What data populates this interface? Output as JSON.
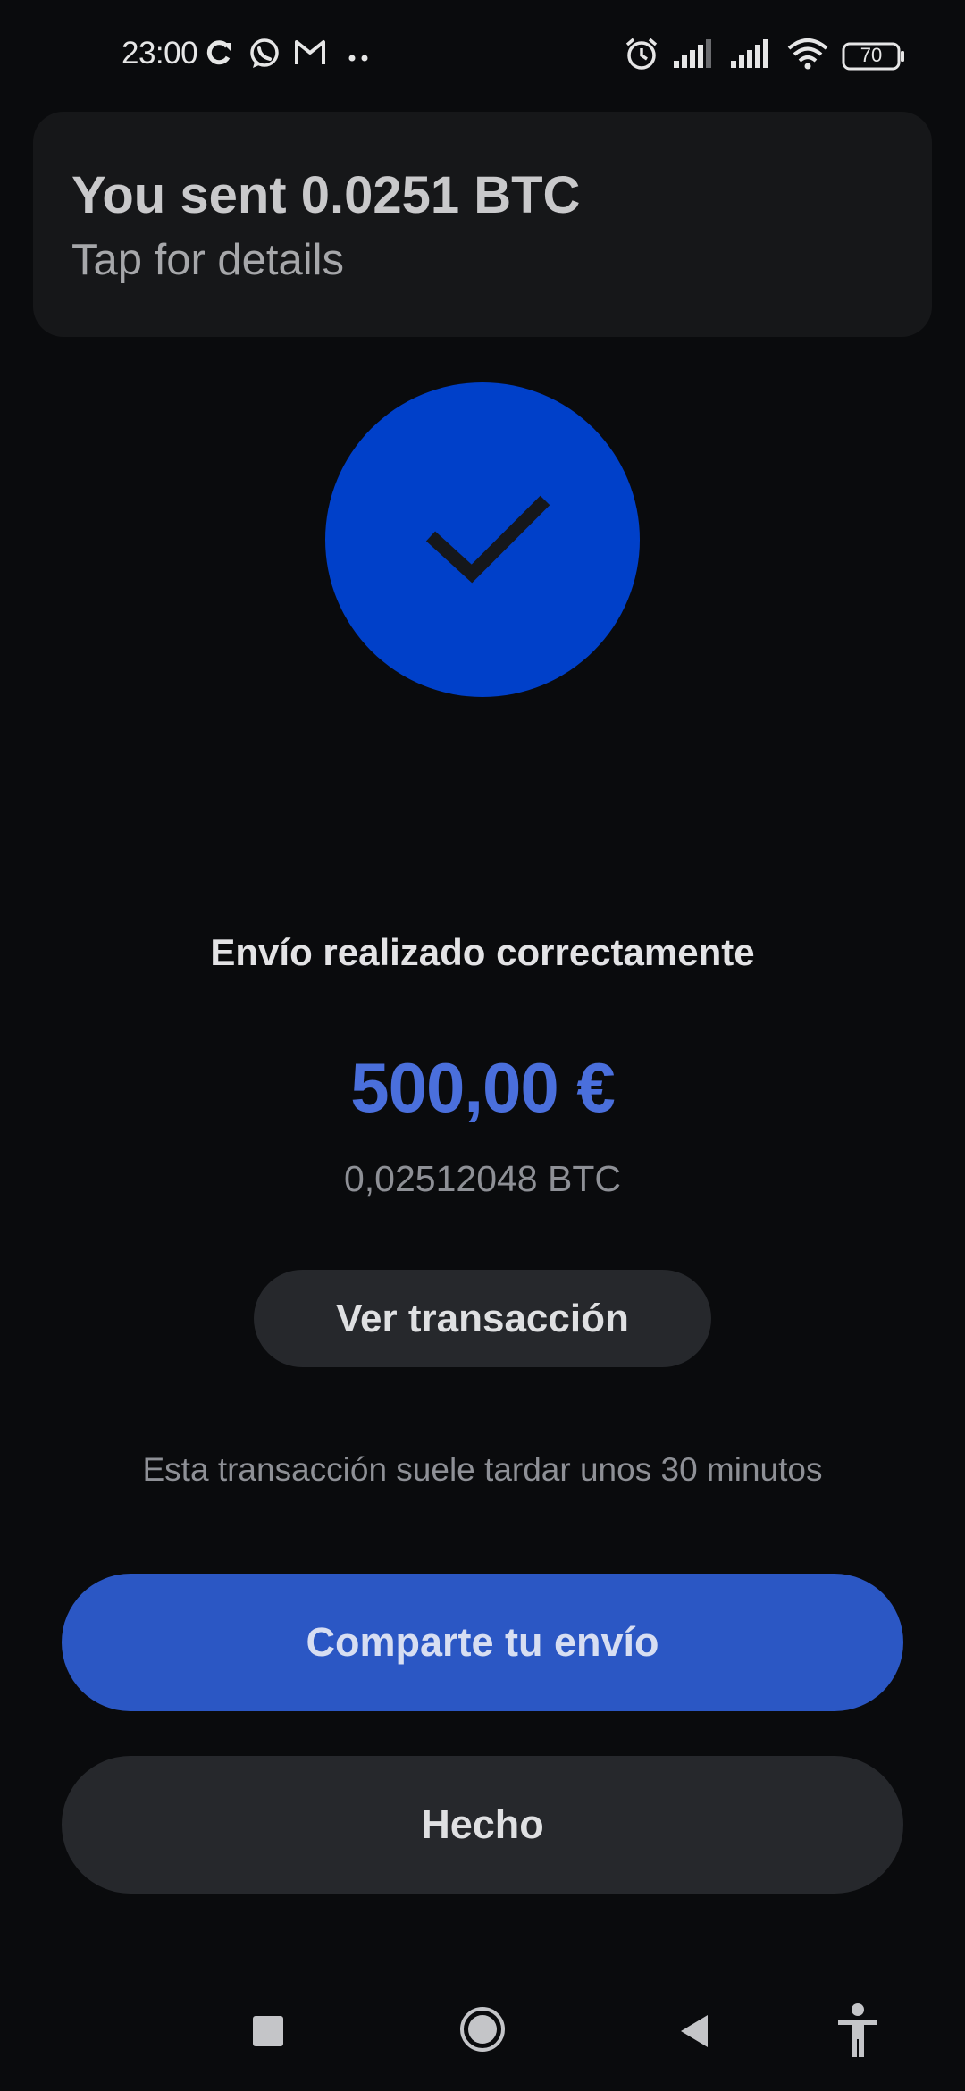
{
  "status_bar": {
    "time": "23:00",
    "battery": "70",
    "icons": [
      "sync-icon",
      "whatsapp-icon",
      "gmail-icon",
      "more-dots-icon",
      "alarm-icon",
      "signal-icon",
      "signal-icon",
      "wifi-icon",
      "battery-icon"
    ]
  },
  "notification": {
    "title": "You sent 0.0251 BTC",
    "subtitle": "Tap for details"
  },
  "success": {
    "icon": "checkmark-icon",
    "circle_color": "#0040c9",
    "title": "Envío realizado correctamente",
    "amount_fiat": "500,00 €",
    "amount_btc": "0,02512048 BTC",
    "view_tx_label": "Ver transacción",
    "note": "Esta transacción suele tardar unos 30 minutos"
  },
  "actions": {
    "share_label": "Comparte tu envío",
    "done_label": "Hecho"
  },
  "colors": {
    "background": "#0a0b0d",
    "accent": "#2b57c4",
    "amount": "#4a6fdc"
  },
  "nav_bar": {
    "icons": [
      "recents-icon",
      "home-icon",
      "back-icon",
      "accessibility-icon"
    ]
  }
}
